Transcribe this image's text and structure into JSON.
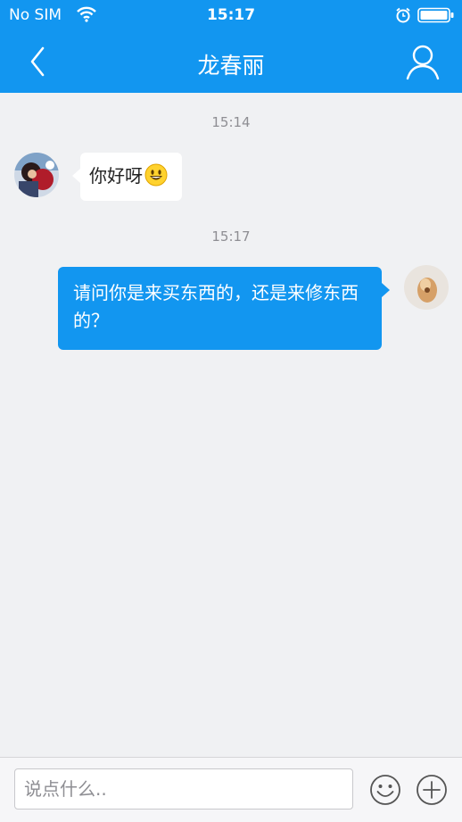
{
  "status_bar": {
    "carrier": "No SIM",
    "time": "15:17",
    "icons": [
      "wifi-icon",
      "alarm-icon",
      "battery-icon"
    ]
  },
  "nav": {
    "title": "龙春丽",
    "back_icon": "chevron-left-icon",
    "profile_icon": "user-icon"
  },
  "messages": [
    {
      "timestamp": "15:14",
      "direction": "incoming",
      "text": "你好呀",
      "emoji": "smiley-emoji-icon"
    },
    {
      "timestamp": "15:17",
      "direction": "outgoing",
      "text": "请问你是来买东西的，还是来修东西的？"
    }
  ],
  "input": {
    "placeholder": "说点什么..",
    "value": "",
    "emoji_icon": "smiley-face-icon",
    "add_icon": "plus-circle-icon"
  },
  "colors": {
    "accent": "#1296f0",
    "background": "#f0f1f3",
    "incoming_bubble": "#ffffff",
    "outgoing_bubble": "#1296f0",
    "timestamp_text": "#8e8e93"
  }
}
